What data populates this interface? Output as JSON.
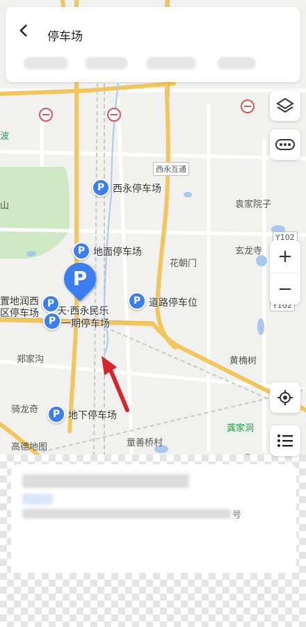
{
  "header": {
    "back_icon": "back-arrow-icon",
    "title": "停车场"
  },
  "map_labels": {
    "xiyong_interchange": "西永互通",
    "yuanjia_yuanzi": "袁家院子",
    "huachaomen": "花朝门",
    "xuanlong_temple": "玄龙寺",
    "zhengjiagou": "郑家沟",
    "huangjueshu": "黄桷树",
    "qilongqi": "骑龙奇",
    "tongshan_qiaocun": "童善桥村",
    "gongjiadong": "龚家洞",
    "gaode_map": "高德地图",
    "bo": "波",
    "shan": "山",
    "zhidirun": "置地润西",
    "qu_parking": "区停车场",
    "tian_xiyong": "天·西永民乐",
    "yiqi_parking": "一期停车场"
  },
  "road_tags": {
    "y102_a": "Y102",
    "y102_b": "Y102"
  },
  "parking_pois": [
    {
      "label": "西永停车场"
    },
    {
      "label": "地面停车场"
    },
    {
      "label": "道路停车位"
    },
    {
      "label": "地下停车场"
    }
  ],
  "selected_pin": "P",
  "controls": {
    "layers_icon": "layers-icon",
    "more_icon": "more-dots-icon",
    "zoom_in": "+",
    "zoom_out": "−",
    "locate_icon": "locate-icon",
    "list_icon": "list-icon"
  },
  "bottom_card": {
    "suffix": "号"
  },
  "colors": {
    "pin_blue": "#3b7ef0",
    "main_road": "#f2c65a",
    "no_entry_red": "#e0525a",
    "arrow_red": "#d7262b"
  }
}
